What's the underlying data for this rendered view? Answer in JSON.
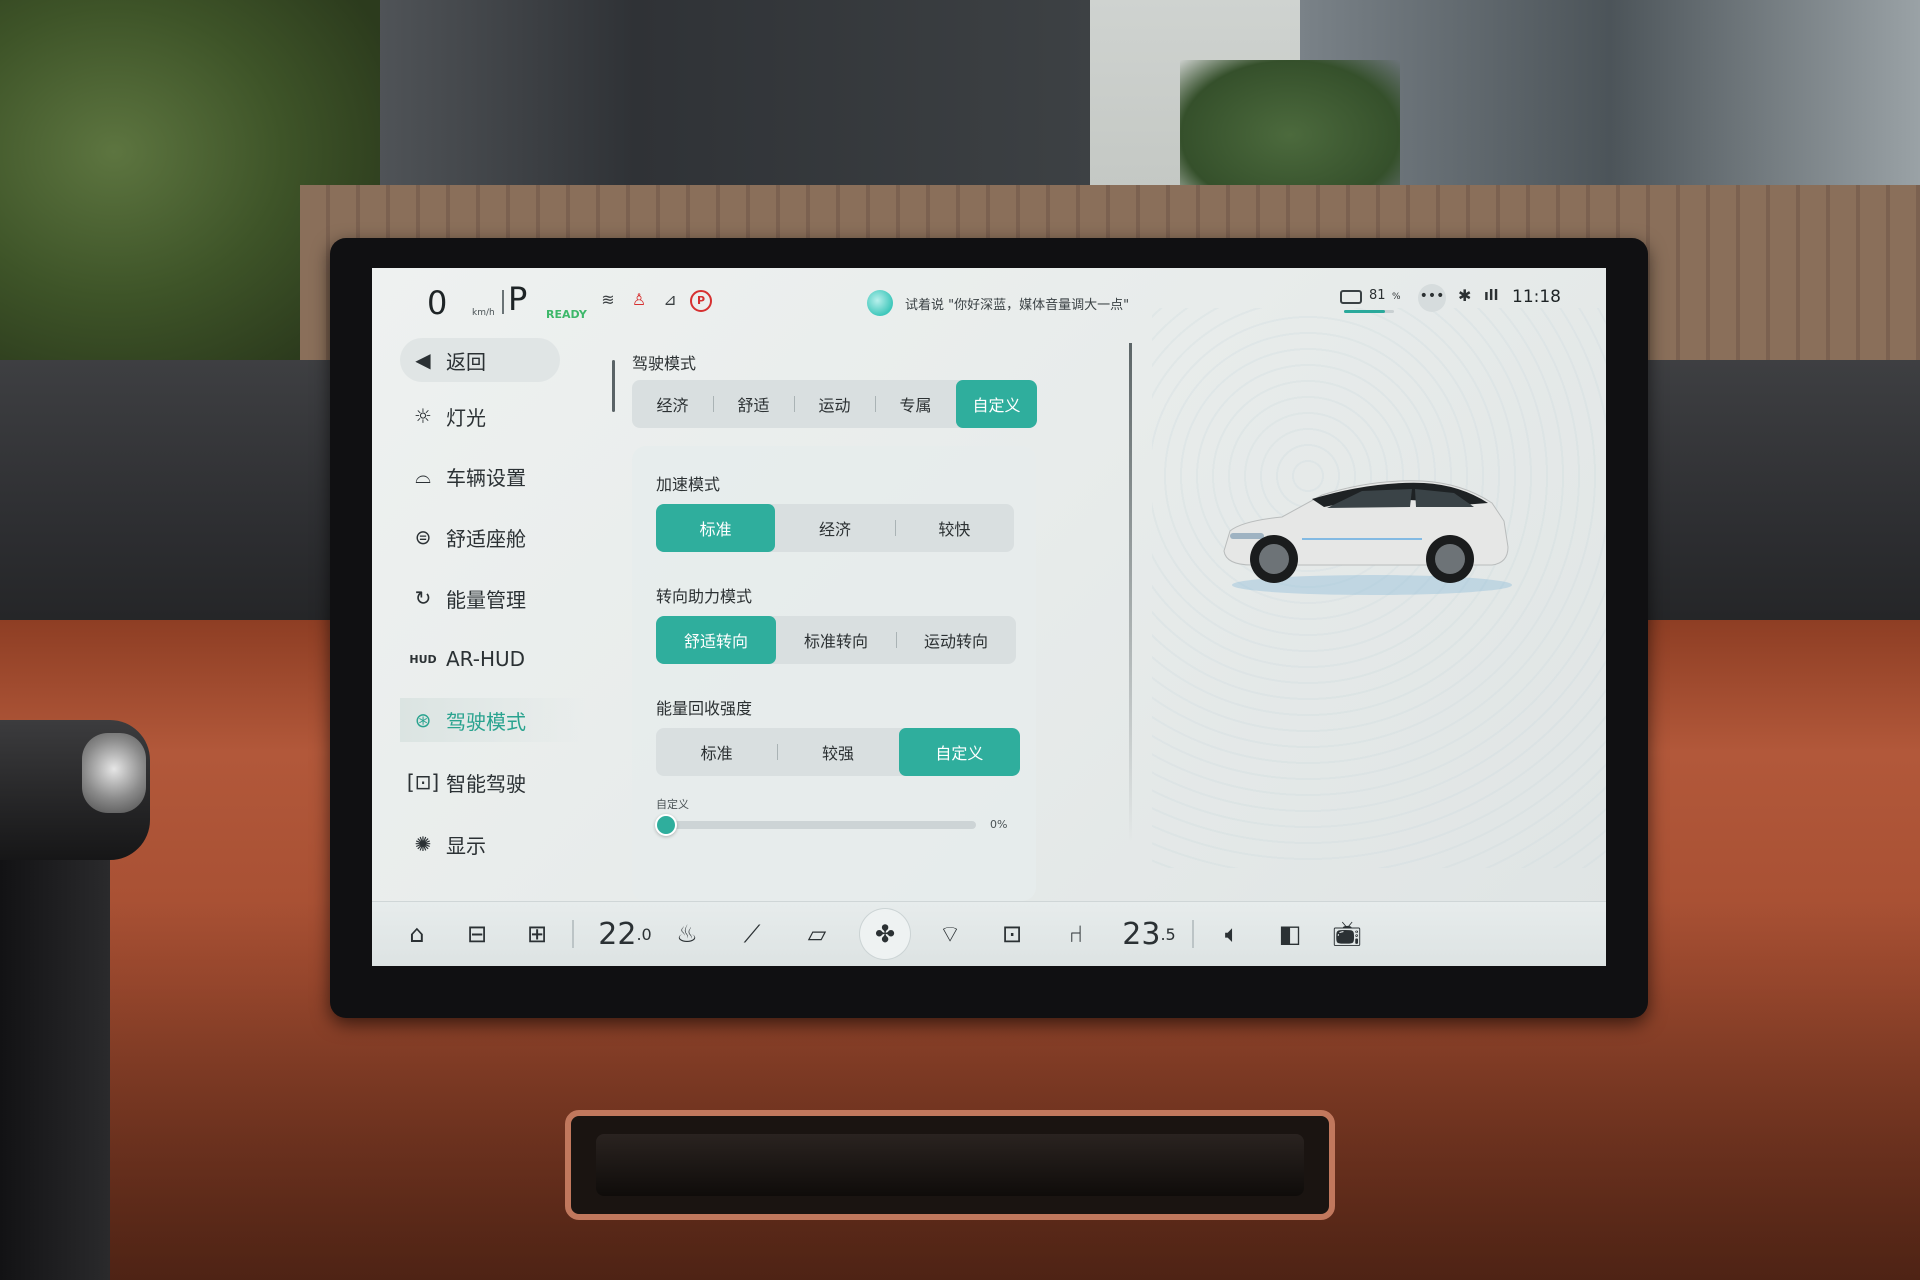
{
  "status": {
    "speed": "0",
    "speed_unit": "km/h",
    "gear": "P",
    "ready": "READY",
    "voice_hint": "试着说 \"你好深蓝，媒体音量调大一点\"",
    "battery_value": "81",
    "battery_unit": "%",
    "battery_level": 0.81,
    "time": "11:18"
  },
  "sidebar": {
    "items": [
      {
        "label": "返回",
        "icon": "back-arrow-icon"
      },
      {
        "label": "灯光",
        "icon": "light-icon"
      },
      {
        "label": "车辆设置",
        "icon": "car-icon"
      },
      {
        "label": "舒适座舱",
        "icon": "seat-icon"
      },
      {
        "label": "能量管理",
        "icon": "energy-icon"
      },
      {
        "label": "AR-HUD",
        "icon": "hud-icon"
      },
      {
        "label": "驾驶模式",
        "icon": "steering-wheel-icon"
      },
      {
        "label": "智能驾驶",
        "icon": "smart-drive-icon"
      },
      {
        "label": "显示",
        "icon": "display-icon"
      }
    ],
    "active": "驾驶模式"
  },
  "drive_mode": {
    "title": "驾驶模式",
    "options": [
      "经济",
      "舒适",
      "运动",
      "专属",
      "自定义"
    ],
    "selected": "自定义"
  },
  "accel_mode": {
    "title": "加速模式",
    "options": [
      "标准",
      "经济",
      "较快"
    ],
    "selected": "标准"
  },
  "steering_mode": {
    "title": "转向助力模式",
    "options": [
      "舒适转向",
      "标准转向",
      "运动转向"
    ],
    "selected": "舒适转向"
  },
  "regen": {
    "title": "能量回收强度",
    "options": [
      "标准",
      "较强",
      "自定义"
    ],
    "selected": "自定义",
    "slider_label": "自定义",
    "slider_value": "0%",
    "slider_level": 0
  },
  "dock": {
    "temp_left_main": "22",
    "temp_left_dec": ".0",
    "temp_right_main": "23",
    "temp_right_dec": ".5",
    "icons": [
      "home-icon",
      "car-icon",
      "apps-grid-icon",
      "seat-heat-icon",
      "wiper-icon",
      "car-view-icon",
      "fan-icon",
      "front-defrost-icon",
      "rear-defrost-icon",
      "seat-vent-icon",
      "volume-icon",
      "split-screen-icon",
      "tv-icon"
    ]
  },
  "colors": {
    "accent": "#2fae9d",
    "ready_green": "#3db86a",
    "warning_red": "#d63030"
  }
}
